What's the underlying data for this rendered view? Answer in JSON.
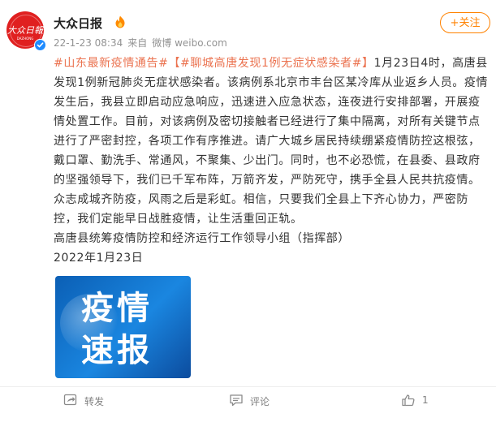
{
  "account": {
    "name": "大众日报",
    "avatar_text": "大众日報",
    "avatar_subtext": "DAZHONG",
    "timestamp": "22-1-23 08:34",
    "source_prefix": "来自",
    "source": "微博 weibo.com",
    "follow_label": "+关注"
  },
  "post": {
    "tag1": "#山东最新疫情通告#",
    "tag2": "【#聊城高唐发现1例无症状感染者#】",
    "p1_text": "1月23日4时，高唐县发现1例新冠肺炎无症状感染者。该病例系北京市丰台区某冷库从业返乡人员。疫情发生后，我县立即启动应急响应，迅速进入应急状态，连夜进行安排部署，开展疫情处置工作。目前，对该病例及密切接触者已经进行了集中隔离，对所有关键节点进行了严密封控，各项工作有序推进。请广大城乡居民持续绷紧疫情防控这根弦，戴口罩、勤洗手、常通风，不聚集、少出门。同时，也不必恐慌，在县委、县政府的坚强领导下，我们已千军布阵，万箭齐发，严防死守，携手全县人民共抗疫情。",
    "p2_text": "众志成城齐防疫，风雨之后是彩虹。相信，只要我们全县上下齐心协力，严密防控，我们定能早日战胜疫情，让生活重回正轨。",
    "signature": "高唐县统筹疫情防控和经济运行工作领导小组（指挥部）",
    "date": "2022年1月23日"
  },
  "media": {
    "line1": "疫情",
    "line2": "速报"
  },
  "actions": {
    "repost_label": "转发",
    "comment_label": "评论",
    "like_count": "1"
  },
  "colors": {
    "accent": "#ff8200",
    "tag": "#eb7350",
    "brand_red": "#e02020",
    "verified_blue": "#1f8bff",
    "media_blue": "#1a86e0"
  },
  "icons": {
    "vip": "fire-badge-icon",
    "verified": "verified-check-icon",
    "repost": "repost-icon",
    "comment": "comment-icon",
    "like": "thumbs-up-icon"
  }
}
